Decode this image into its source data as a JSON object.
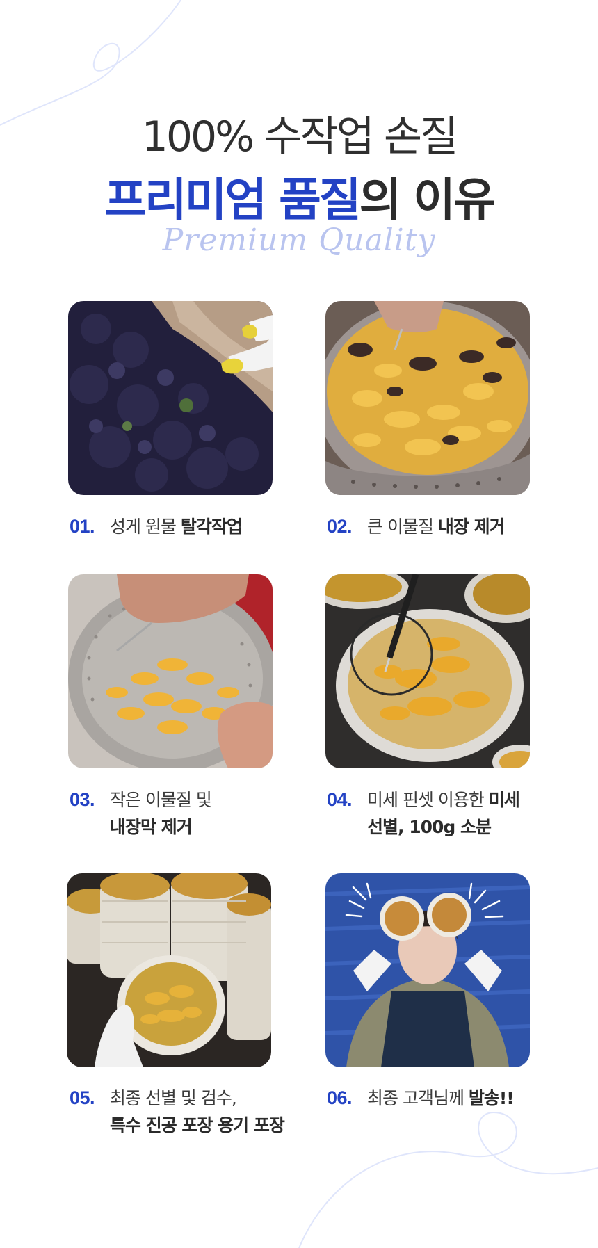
{
  "heading": {
    "line1": "100% 수작업 손질",
    "line2_accent": "프리미엄 품질",
    "line2_rest": "의 이유",
    "script": "Premium Quality"
  },
  "colors": {
    "accent": "#2342c4",
    "text": "#333333",
    "script": "#b9c4ef",
    "decor_line": "#dfe5fb"
  },
  "steps": [
    {
      "num": "01.",
      "line1_plain": "성게 원물 ",
      "line1_bold": "탈각작업",
      "line2_plain": "",
      "line2_bold": "",
      "photo": "sea-urchins-on-shore-photo"
    },
    {
      "num": "02.",
      "line1_plain": "큰 이물질 ",
      "line1_bold": "내장 제거",
      "line2_plain": "",
      "line2_bold": "",
      "photo": "urchin-roe-in-strainer-photo"
    },
    {
      "num": "03.",
      "line1_plain": "작은 이물질 및",
      "line1_bold": "",
      "line2_plain": "",
      "line2_bold": "내장막 제거",
      "photo": "cleaning-roe-strainer-photo"
    },
    {
      "num": "04.",
      "line1_plain": "미세 핀셋 이용한 ",
      "line1_bold": "미세",
      "line2_plain": "선별, 100g 소분",
      "line2_bold": "",
      "photo": "tweezers-sorting-roe-photo"
    },
    {
      "num": "05.",
      "line1_plain": "최종 선별 및 검수,",
      "line1_bold": "",
      "line2_plain": "",
      "line2_bold": "특수 진공 포장 용기 포장",
      "photo": "packed-containers-photo"
    },
    {
      "num": "06.",
      "line1_plain": "최종 고객님께 ",
      "line1_bold": "발송!!",
      "line2_plain": "",
      "line2_bold": "",
      "photo": "worker-holding-containers-photo"
    }
  ]
}
